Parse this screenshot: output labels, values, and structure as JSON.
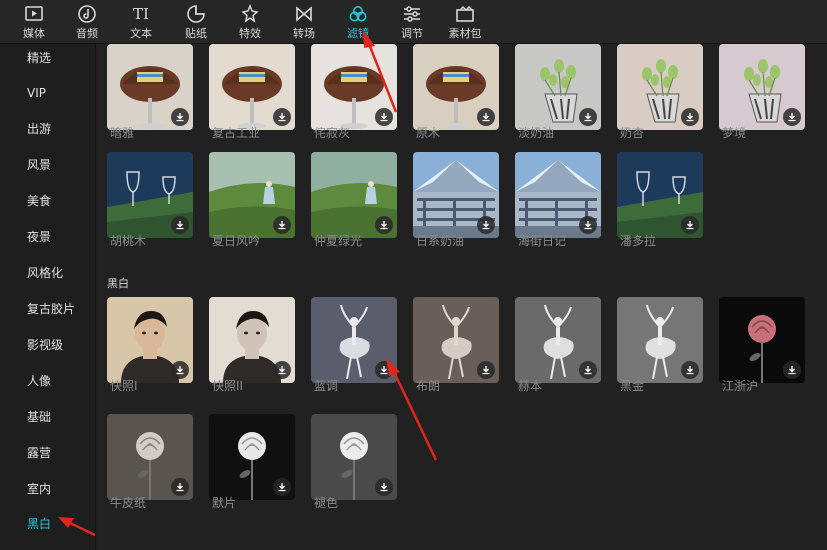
{
  "tabs": [
    {
      "label": "媒体",
      "icon": "media-icon"
    },
    {
      "label": "音频",
      "icon": "audio-icon"
    },
    {
      "label": "文本",
      "icon": "text-icon"
    },
    {
      "label": "贴纸",
      "icon": "sticker-icon"
    },
    {
      "label": "特效",
      "icon": "effects-icon"
    },
    {
      "label": "转场",
      "icon": "transition-icon"
    },
    {
      "label": "滤镜",
      "icon": "filter-icon",
      "active": true
    },
    {
      "label": "调节",
      "icon": "adjust-icon"
    },
    {
      "label": "素材包",
      "icon": "package-icon"
    }
  ],
  "sidebar": [
    "精选",
    "VIP",
    "出游",
    "风景",
    "美食",
    "夜景",
    "风格化",
    "复古胶片",
    "影视级",
    "人像",
    "基础",
    "露营",
    "室内",
    "黑白"
  ],
  "sidebar_active": "黑白",
  "accent_color": "#22c8d8",
  "section_bw": "黑白",
  "row1": [
    "暗雅",
    "复古工业",
    "侘寂灰",
    "原木",
    "淡奶油",
    "奶杏",
    "梦境"
  ],
  "row2": [
    "胡桃木",
    "夏日风吟",
    "仲夏绿光",
    "日系奶油",
    "海街日记",
    "潘多拉"
  ],
  "row3": [
    "快照I",
    "快照II",
    "蓝调",
    "布朗",
    "赫本",
    "黑金",
    "江浙沪"
  ],
  "row4": [
    "牛皮纸",
    "默片",
    "褪色"
  ]
}
